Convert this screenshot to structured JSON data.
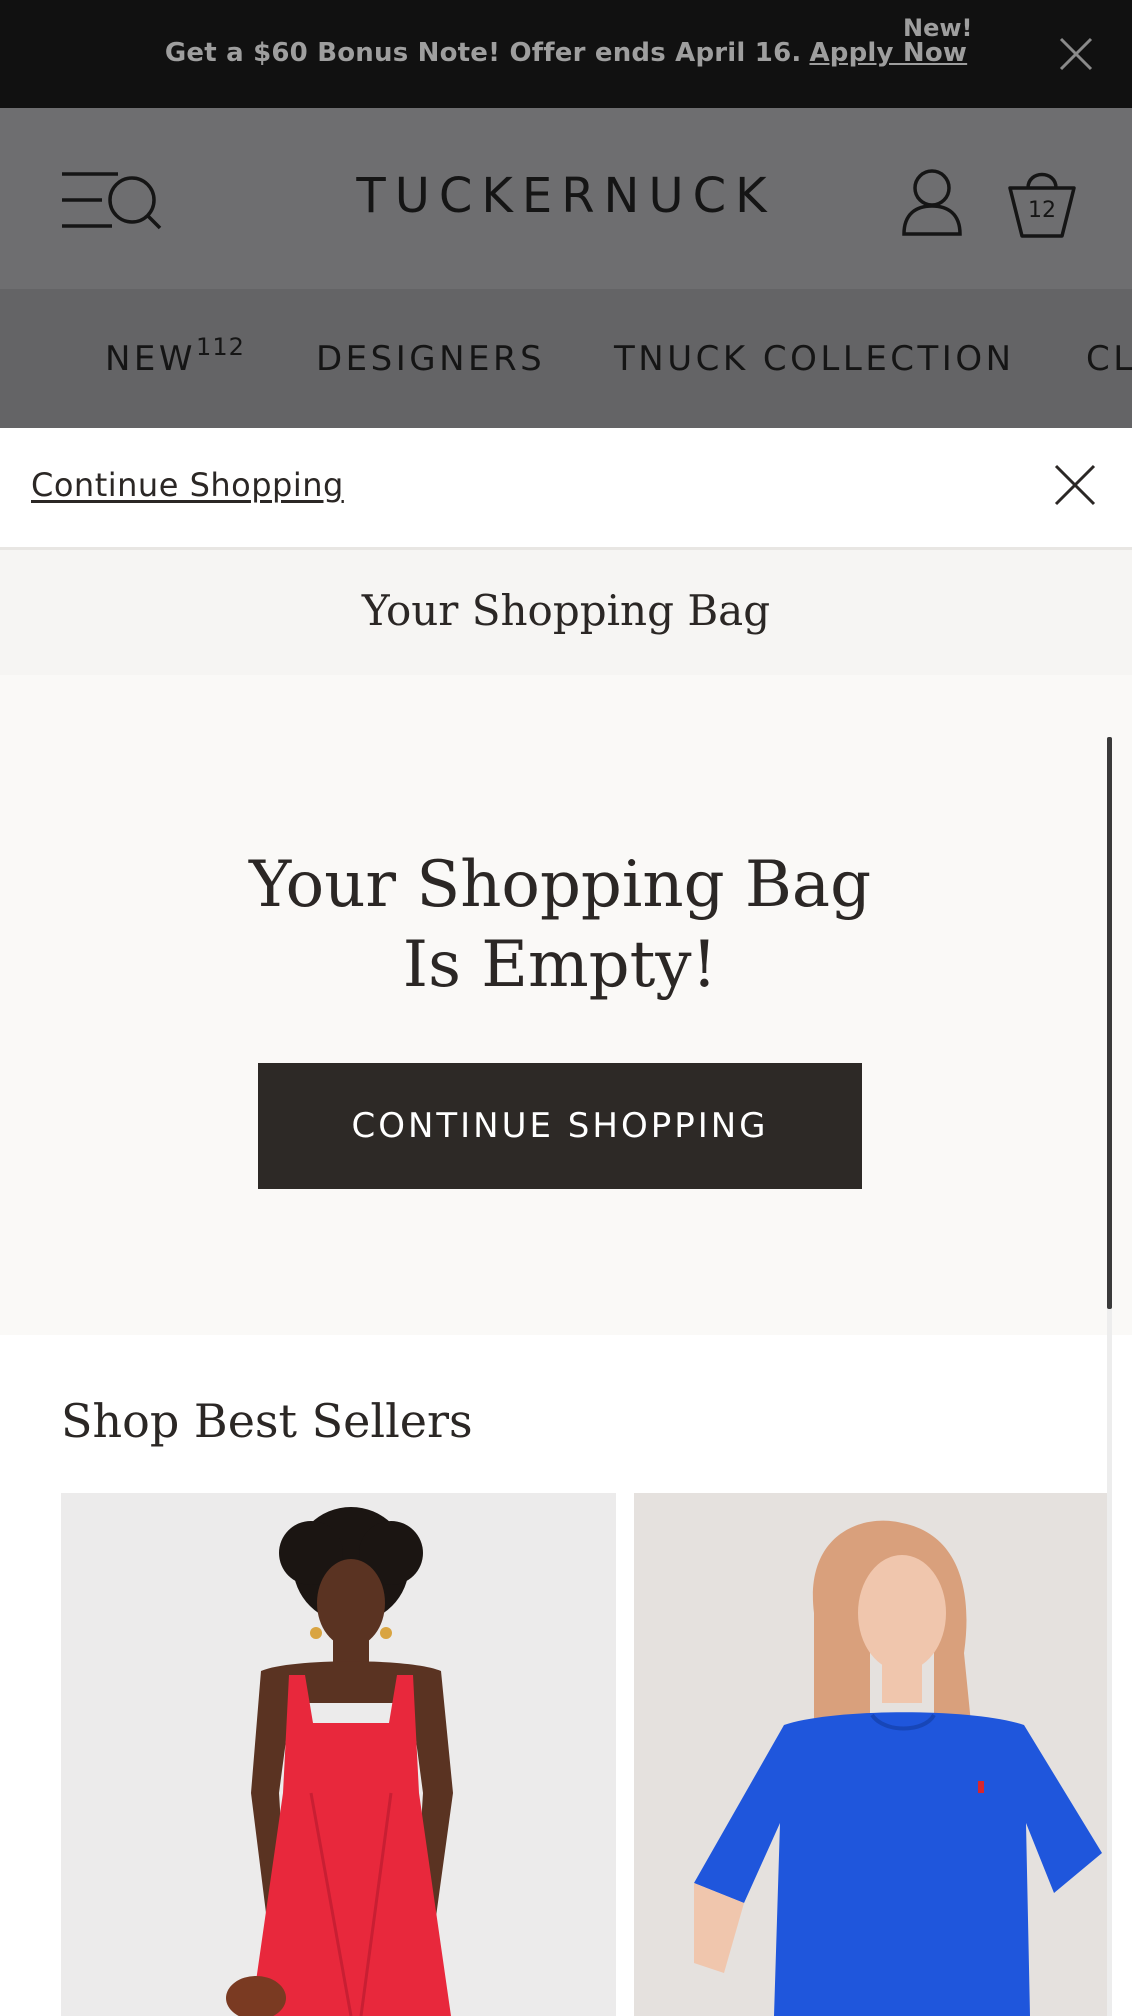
{
  "promo": {
    "message": "Get a $60 Bonus Note! Offer ends April 16.",
    "apply_label": "Apply Now",
    "new_label": "New!"
  },
  "header": {
    "logo": "TUCKERNUCK",
    "bag_count": "12"
  },
  "nav": {
    "items": [
      {
        "label": "NEW",
        "count": "112"
      },
      {
        "label": "DESIGNERS"
      },
      {
        "label": "TNUCK COLLECTION"
      },
      {
        "label": "CL"
      }
    ]
  },
  "drawer": {
    "continue_link": "Continue Shopping",
    "title": "Your Shopping Bag",
    "empty_line1": "Your Shopping Bag",
    "empty_line2": "Is Empty!",
    "cta_label": "CONTINUE SHOPPING"
  },
  "bestsellers": {
    "title": "Shop Best Sellers"
  },
  "colors": {
    "promo_bg": "#111111",
    "header_overlay": "#6e6e70",
    "cta_bg": "#2d2926",
    "dress_red": "#e8283c",
    "dress_blue": "#1f56dc"
  }
}
